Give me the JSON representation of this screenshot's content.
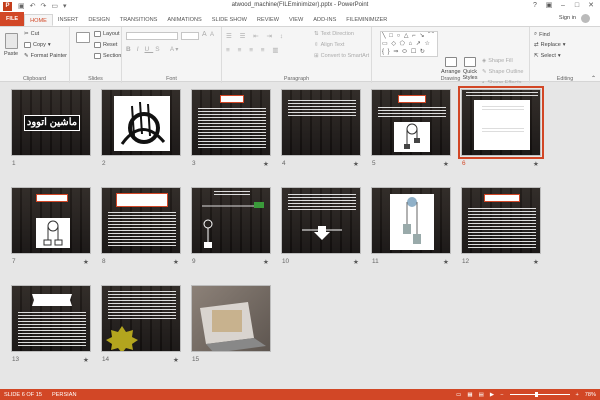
{
  "window": {
    "title": "atwood_machine(FILEminimizer).pptx - PowerPoint",
    "app_icon_letter": "P",
    "sign_in": "Sign in"
  },
  "tabs": [
    "FILE",
    "HOME",
    "INSERT",
    "DESIGN",
    "TRANSITIONS",
    "ANIMATIONS",
    "SLIDE SHOW",
    "REVIEW",
    "VIEW",
    "ADD-INS",
    "FILEminimizer"
  ],
  "ribbon": {
    "clipboard": {
      "label": "Clipboard",
      "paste": "Paste",
      "cut": "Cut",
      "copy": "Copy",
      "format_painter": "Format Painter"
    },
    "slides": {
      "label": "Slides",
      "new_slide": "New Slide",
      "layout": "Layout",
      "reset": "Reset",
      "section": "Section"
    },
    "font": {
      "label": "Font"
    },
    "paragraph": {
      "label": "Paragraph",
      "text_direction": "Text Direction",
      "align_text": "Align Text",
      "convert_smartart": "Convert to SmartArt"
    },
    "drawing": {
      "label": "Drawing",
      "arrange": "Arrange",
      "quick_styles": "Quick Styles",
      "shape_fill": "Shape Fill",
      "shape_outline": "Shape Outline",
      "shape_effects": "Shape Effects"
    },
    "editing": {
      "label": "Editing",
      "find": "Find",
      "replace": "Replace",
      "select": "Select"
    }
  },
  "slides": [
    {
      "num": "1",
      "title": "ماشین اتوود",
      "star": ""
    },
    {
      "num": "2",
      "star": ""
    },
    {
      "num": "3",
      "star": "★"
    },
    {
      "num": "4",
      "star": "★"
    },
    {
      "num": "5",
      "star": "★"
    },
    {
      "num": "6",
      "star": "★"
    },
    {
      "num": "7",
      "star": "★"
    },
    {
      "num": "8",
      "star": "★"
    },
    {
      "num": "9",
      "star": "★"
    },
    {
      "num": "10",
      "star": "★"
    },
    {
      "num": "11",
      "star": "★"
    },
    {
      "num": "12",
      "star": "★"
    },
    {
      "num": "13",
      "star": "★"
    },
    {
      "num": "14",
      "star": "★"
    },
    {
      "num": "15",
      "star": ""
    }
  ],
  "status": {
    "slide_info": "SLIDE 6 OF 15",
    "language": "PERSIAN",
    "zoom": "78%"
  }
}
